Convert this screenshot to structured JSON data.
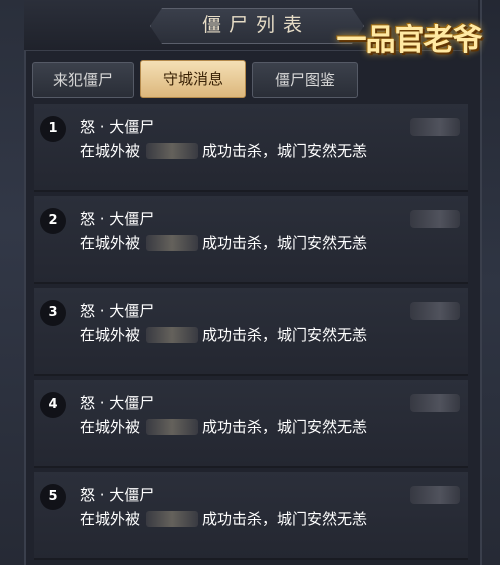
{
  "header": {
    "title": "僵尸列表",
    "logo_text": "一品官老爷"
  },
  "tabs": [
    {
      "label": "来犯僵尸",
      "active": false
    },
    {
      "label": "守城消息",
      "active": true
    },
    {
      "label": "僵尸图鉴",
      "active": false
    }
  ],
  "messages": [
    {
      "rank": "1",
      "zombie": "怒 · 大僵尸",
      "prefix": "在城外被",
      "suffix": "成功击杀，城门安然无恙"
    },
    {
      "rank": "2",
      "zombie": "怒 · 大僵尸",
      "prefix": "在城外被",
      "suffix": "成功击杀，城门安然无恙"
    },
    {
      "rank": "3",
      "zombie": "怒 · 大僵尸",
      "prefix": "在城外被",
      "suffix": "成功击杀，城门安然无恙"
    },
    {
      "rank": "4",
      "zombie": "怒 · 大僵尸",
      "prefix": "在城外被",
      "suffix": "成功击杀，城门安然无恙"
    },
    {
      "rank": "5",
      "zombie": "怒 · 大僵尸",
      "prefix": "在城外被",
      "suffix": "成功击杀，城门安然无恙"
    }
  ],
  "colors": {
    "active_tab": "#e8c890",
    "panel_bg": "#20232d",
    "row_bg": "#2a2e39"
  }
}
